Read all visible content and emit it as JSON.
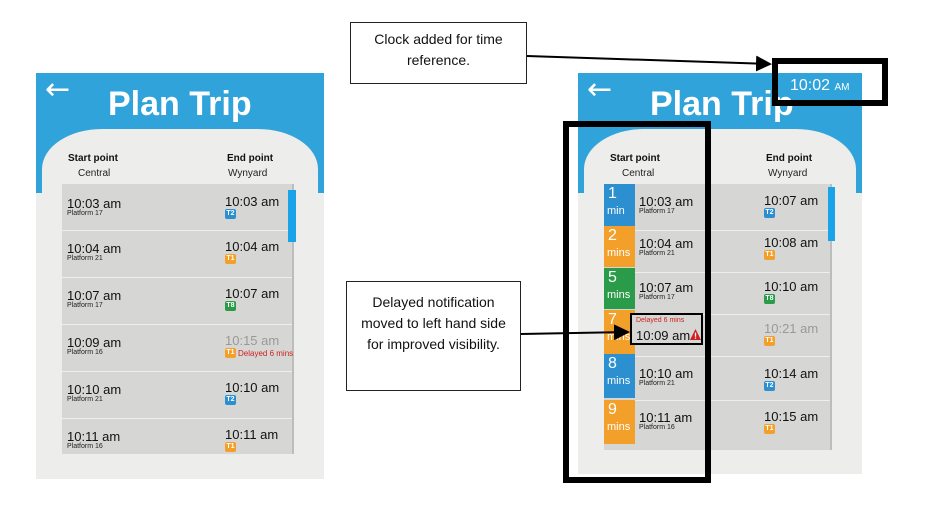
{
  "left": {
    "title": "Plan Trip",
    "back_icon": "back-arrow-icon",
    "start_label": "Start point",
    "end_label": "End point",
    "start_value": "Central",
    "end_value": "Wynyard",
    "rows": [
      {
        "dep": "10:03 am",
        "platform": "Platform 17",
        "arr": "10:03 am",
        "line": "T2"
      },
      {
        "dep": "10:04 am",
        "platform": "Platform 21",
        "arr": "10:04 am",
        "line": "T1"
      },
      {
        "dep": "10:07 am",
        "platform": "Platform 17",
        "arr": "10:07 am",
        "line": "T8"
      },
      {
        "dep": "10:09 am",
        "platform": "Platform 16",
        "arr": "10:15 am",
        "line": "T1",
        "delay": "Delayed 6 mins"
      },
      {
        "dep": "10:10 am",
        "platform": "Platform 21",
        "arr": "10:10 am",
        "line": "T2"
      },
      {
        "dep": "10:11 am",
        "platform": "Platform 16",
        "arr": "10:11 am",
        "line": "T1"
      }
    ]
  },
  "right": {
    "title": "Plan Trip",
    "clock": "10:02",
    "clock_suffix": "AM",
    "start_label": "Start point",
    "end_label": "End point",
    "start_value": "Central",
    "end_value": "Wynyard",
    "rows": [
      {
        "mins": "1",
        "unit": "min",
        "dep": "10:03 am",
        "platform": "Platform 17",
        "arr": "10:07 am",
        "line": "T2"
      },
      {
        "mins": "2",
        "unit": "mins",
        "dep": "10:04 am",
        "platform": "Platform 21",
        "arr": "10:08 am",
        "line": "T1"
      },
      {
        "mins": "5",
        "unit": "mins",
        "dep": "10:07 am",
        "platform": "Platform 17",
        "arr": "10:10 am",
        "line": "T8"
      },
      {
        "mins": "7",
        "unit": "mins",
        "dep": "10:09 am",
        "platform": "",
        "arr": "10:21 am",
        "line": "T1",
        "delay": "Delayed 6 mins"
      },
      {
        "mins": "8",
        "unit": "mins",
        "dep": "10:10 am",
        "platform": "Platform 21",
        "arr": "10:14 am",
        "line": "T2"
      },
      {
        "mins": "9",
        "unit": "mins",
        "dep": "10:11 am",
        "platform": "Platform 16",
        "arr": "10:15 am",
        "line": "T1"
      }
    ]
  },
  "annotations": {
    "clock_note": "Clock added for time reference.",
    "delay_note": "Delayed notification moved to left hand side for improved visibility."
  },
  "colors": {
    "header": "#2fa3da",
    "t1": "#f3a02b",
    "t2": "#2b8fd0",
    "t8": "#2a9b48",
    "delay": "#cc2222"
  }
}
